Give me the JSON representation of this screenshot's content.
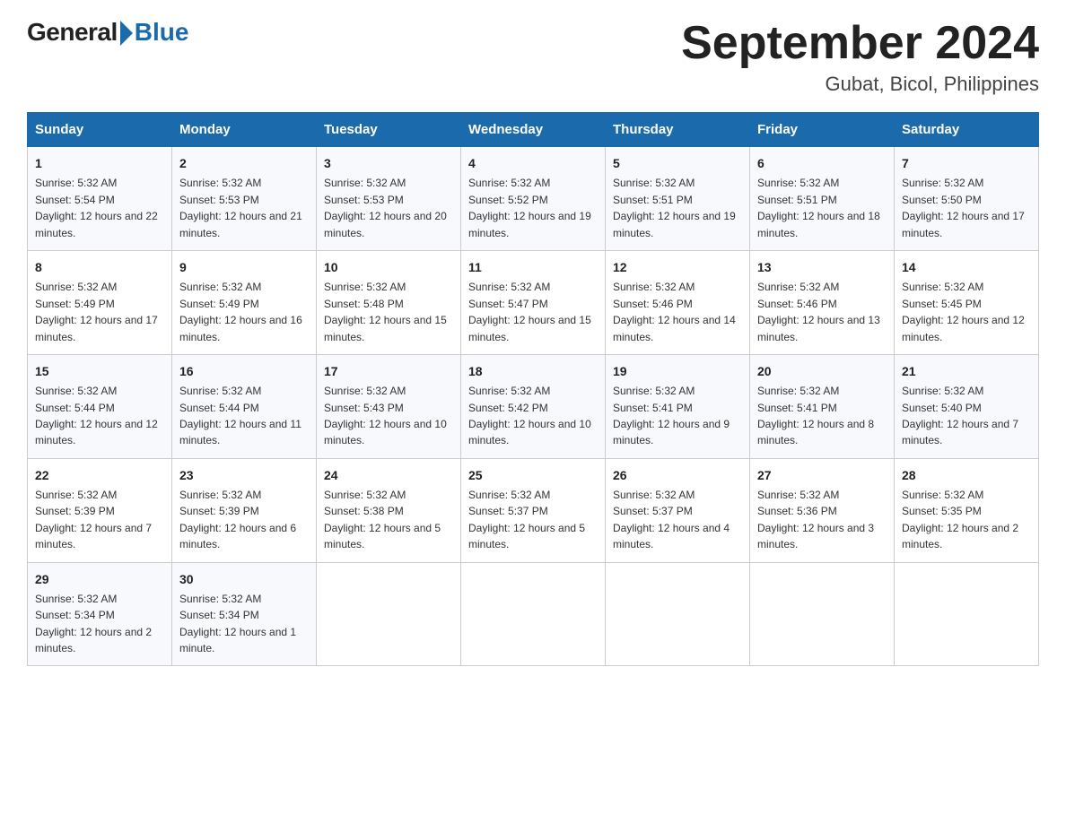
{
  "logo": {
    "general": "General",
    "blue": "Blue"
  },
  "title": "September 2024",
  "location": "Gubat, Bicol, Philippines",
  "days_of_week": [
    "Sunday",
    "Monday",
    "Tuesday",
    "Wednesday",
    "Thursday",
    "Friday",
    "Saturday"
  ],
  "weeks": [
    [
      {
        "day": "1",
        "sunrise": "5:32 AM",
        "sunset": "5:54 PM",
        "daylight": "12 hours and 22 minutes."
      },
      {
        "day": "2",
        "sunrise": "5:32 AM",
        "sunset": "5:53 PM",
        "daylight": "12 hours and 21 minutes."
      },
      {
        "day": "3",
        "sunrise": "5:32 AM",
        "sunset": "5:53 PM",
        "daylight": "12 hours and 20 minutes."
      },
      {
        "day": "4",
        "sunrise": "5:32 AM",
        "sunset": "5:52 PM",
        "daylight": "12 hours and 19 minutes."
      },
      {
        "day": "5",
        "sunrise": "5:32 AM",
        "sunset": "5:51 PM",
        "daylight": "12 hours and 19 minutes."
      },
      {
        "day": "6",
        "sunrise": "5:32 AM",
        "sunset": "5:51 PM",
        "daylight": "12 hours and 18 minutes."
      },
      {
        "day": "7",
        "sunrise": "5:32 AM",
        "sunset": "5:50 PM",
        "daylight": "12 hours and 17 minutes."
      }
    ],
    [
      {
        "day": "8",
        "sunrise": "5:32 AM",
        "sunset": "5:49 PM",
        "daylight": "12 hours and 17 minutes."
      },
      {
        "day": "9",
        "sunrise": "5:32 AM",
        "sunset": "5:49 PM",
        "daylight": "12 hours and 16 minutes."
      },
      {
        "day": "10",
        "sunrise": "5:32 AM",
        "sunset": "5:48 PM",
        "daylight": "12 hours and 15 minutes."
      },
      {
        "day": "11",
        "sunrise": "5:32 AM",
        "sunset": "5:47 PM",
        "daylight": "12 hours and 15 minutes."
      },
      {
        "day": "12",
        "sunrise": "5:32 AM",
        "sunset": "5:46 PM",
        "daylight": "12 hours and 14 minutes."
      },
      {
        "day": "13",
        "sunrise": "5:32 AM",
        "sunset": "5:46 PM",
        "daylight": "12 hours and 13 minutes."
      },
      {
        "day": "14",
        "sunrise": "5:32 AM",
        "sunset": "5:45 PM",
        "daylight": "12 hours and 12 minutes."
      }
    ],
    [
      {
        "day": "15",
        "sunrise": "5:32 AM",
        "sunset": "5:44 PM",
        "daylight": "12 hours and 12 minutes."
      },
      {
        "day": "16",
        "sunrise": "5:32 AM",
        "sunset": "5:44 PM",
        "daylight": "12 hours and 11 minutes."
      },
      {
        "day": "17",
        "sunrise": "5:32 AM",
        "sunset": "5:43 PM",
        "daylight": "12 hours and 10 minutes."
      },
      {
        "day": "18",
        "sunrise": "5:32 AM",
        "sunset": "5:42 PM",
        "daylight": "12 hours and 10 minutes."
      },
      {
        "day": "19",
        "sunrise": "5:32 AM",
        "sunset": "5:41 PM",
        "daylight": "12 hours and 9 minutes."
      },
      {
        "day": "20",
        "sunrise": "5:32 AM",
        "sunset": "5:41 PM",
        "daylight": "12 hours and 8 minutes."
      },
      {
        "day": "21",
        "sunrise": "5:32 AM",
        "sunset": "5:40 PM",
        "daylight": "12 hours and 7 minutes."
      }
    ],
    [
      {
        "day": "22",
        "sunrise": "5:32 AM",
        "sunset": "5:39 PM",
        "daylight": "12 hours and 7 minutes."
      },
      {
        "day": "23",
        "sunrise": "5:32 AM",
        "sunset": "5:39 PM",
        "daylight": "12 hours and 6 minutes."
      },
      {
        "day": "24",
        "sunrise": "5:32 AM",
        "sunset": "5:38 PM",
        "daylight": "12 hours and 5 minutes."
      },
      {
        "day": "25",
        "sunrise": "5:32 AM",
        "sunset": "5:37 PM",
        "daylight": "12 hours and 5 minutes."
      },
      {
        "day": "26",
        "sunrise": "5:32 AM",
        "sunset": "5:37 PM",
        "daylight": "12 hours and 4 minutes."
      },
      {
        "day": "27",
        "sunrise": "5:32 AM",
        "sunset": "5:36 PM",
        "daylight": "12 hours and 3 minutes."
      },
      {
        "day": "28",
        "sunrise": "5:32 AM",
        "sunset": "5:35 PM",
        "daylight": "12 hours and 2 minutes."
      }
    ],
    [
      {
        "day": "29",
        "sunrise": "5:32 AM",
        "sunset": "5:34 PM",
        "daylight": "12 hours and 2 minutes."
      },
      {
        "day": "30",
        "sunrise": "5:32 AM",
        "sunset": "5:34 PM",
        "daylight": "12 hours and 1 minute."
      },
      null,
      null,
      null,
      null,
      null
    ]
  ]
}
